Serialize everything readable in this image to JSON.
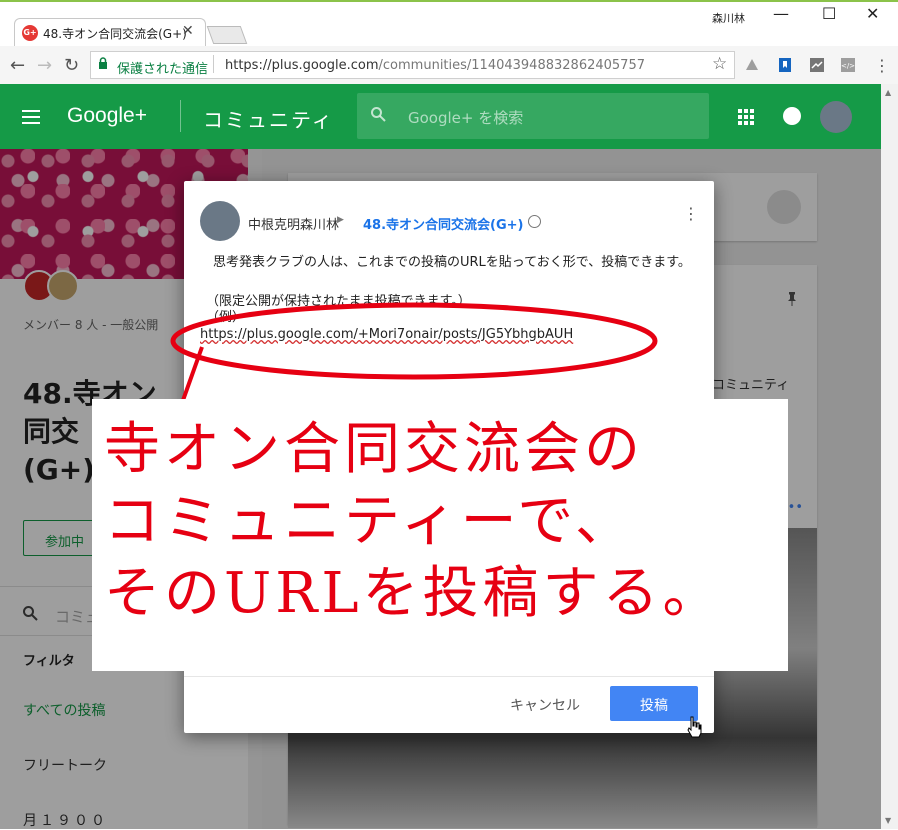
{
  "browser": {
    "tab_title": "48.寺オン合同交流会(G+)",
    "tab_favicon": "G+",
    "user_name": "森川林",
    "window_controls": [
      "—",
      "☐",
      "✕"
    ],
    "secure_label": "保護された通信",
    "url_domain": "https://plus.google.com",
    "url_path": "/communities/114043948832862405757"
  },
  "header": {
    "logo": "Google+",
    "section": "コミュニティ",
    "search_placeholder": "Google+ を検索",
    "brand_color": "#159a47"
  },
  "sidebar": {
    "members": "メンバー 8 人 - 一般公開",
    "community_title_lines": [
      "48.寺オン",
      "同交",
      "(G+)"
    ],
    "join_label": "参加中",
    "search_placeholder": "コミュ",
    "filter_label": "フィルタ",
    "filters": [
      "すべての投稿",
      "フリートーク",
      "月１９００"
    ]
  },
  "main": {
    "side_text": "コミュニティ",
    "more_dots": "•••"
  },
  "dialog": {
    "author": "中根克明森川林",
    "community": "48.寺オン合同交流会(G+)",
    "body_line1": "　思考発表クラブの人は、これまでの投稿のURLを貼っておく形で、投稿できます。",
    "body_line2": "（限定公開が保持されたまま投稿できます。）",
    "body_line3": "（例）",
    "link": "https://plus.google.com/+Mori7onair/posts/JG5YbhgbAUH",
    "cancel_label": "キャンセル",
    "post_label": "投稿",
    "accent_color": "#4285f4"
  },
  "annotation": {
    "text": "寺オン合同交流会の\nコミュニティーで、\nそのURLを投稿する。",
    "color": "#e60012"
  }
}
